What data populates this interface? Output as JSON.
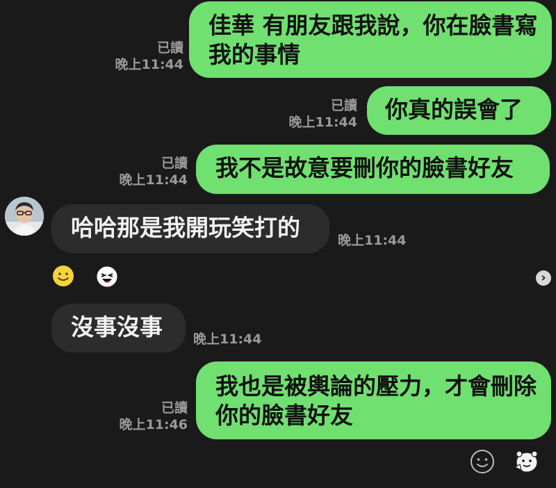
{
  "messages": [
    {
      "from": "me",
      "text": "佳華 有朋友跟我說，你在臉書寫我的事情",
      "read": "已讀",
      "time": "晚上11:44"
    },
    {
      "from": "me",
      "text": "你真的誤會了",
      "read": "已讀",
      "time": "晚上11:44"
    },
    {
      "from": "me",
      "text": "我不是故意要刪你的臉書好友",
      "read": "已讀",
      "time": "晚上11:44"
    },
    {
      "from": "them",
      "text": "哈哈那是我開玩笑打的",
      "time": "晚上11:44"
    },
    {
      "from": "them",
      "text": "沒事沒事",
      "time": "晚上11:44"
    },
    {
      "from": "me",
      "text": "我也是被輿論的壓力，才會刪除你的臉書好友",
      "read": "已讀",
      "time": "晚上11:46"
    }
  ],
  "colors": {
    "background": "#1a1a1a",
    "outgoing_bubble": "#70e070",
    "incoming_bubble": "#2c2c2c",
    "meta_text": "#9a9a9a"
  },
  "icons": {
    "reaction_1": "smiley-face-icon",
    "reaction_2": "laughing-sticker-icon",
    "more": "chevron-right-icon",
    "emoji": "smiley-outline-icon",
    "sticker": "sticker-icon"
  }
}
